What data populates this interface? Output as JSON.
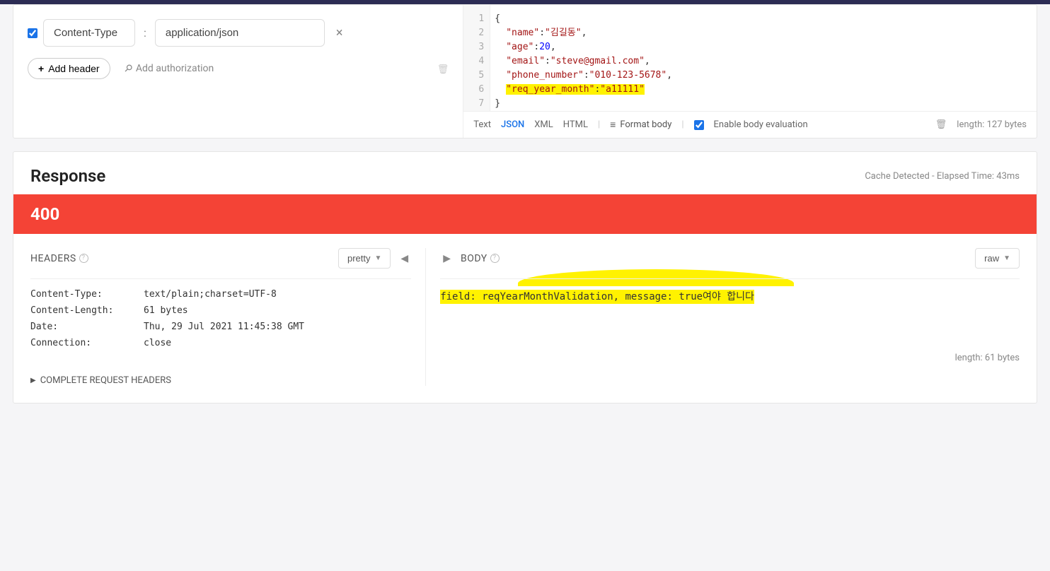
{
  "headers": {
    "name": "Content-Type",
    "value": "application/json",
    "colon": ":",
    "addHeader": "Add header",
    "addAuth": "Add authorization"
  },
  "jsonBody": {
    "lines": [
      "1",
      "2",
      "3",
      "4",
      "5",
      "6",
      "7"
    ],
    "keys": {
      "name": "\"name\"",
      "age": "\"age\"",
      "email": "\"email\"",
      "phone": "\"phone_number\"",
      "req": "\"req_year_month\""
    },
    "vals": {
      "name": "\"김길동\"",
      "age": "20",
      "email": "\"steve@gmail.com\"",
      "phone": "\"010-123-5678\"",
      "req": "\"a11111\""
    },
    "braceOpen": "{",
    "braceClose": "}",
    "comma": ",",
    "colon": ":"
  },
  "editorFooter": {
    "text": "Text",
    "json": "JSON",
    "xml": "XML",
    "html": "HTML",
    "formatBody": "Format body",
    "enableEval": "Enable body evaluation",
    "length": "length: 127 bytes"
  },
  "response": {
    "title": "Response",
    "cache": "Cache Detected - Elapsed Time: 43ms",
    "status": "400",
    "headersTitle": "HEADERS",
    "bodyTitle": "BODY",
    "prettyLabel": "pretty",
    "rawLabel": "raw",
    "headerRows": {
      "ct_k": "Content-Type:",
      "ct_v": "text/plain;charset=UTF-8",
      "cl_k": "Content-Length:",
      "cl_v": "61 bytes",
      "dt_k": "Date:",
      "dt_v": "Thu, 29 Jul 2021 11:45:38 GMT",
      "cn_k": "Connection:",
      "cn_v": "close"
    },
    "completeHeaders": "COMPLETE REQUEST HEADERS",
    "bodyText": "field: reqYearMonthValidation,   message: true여야 합니다",
    "bodyLength": "length: 61 bytes"
  }
}
